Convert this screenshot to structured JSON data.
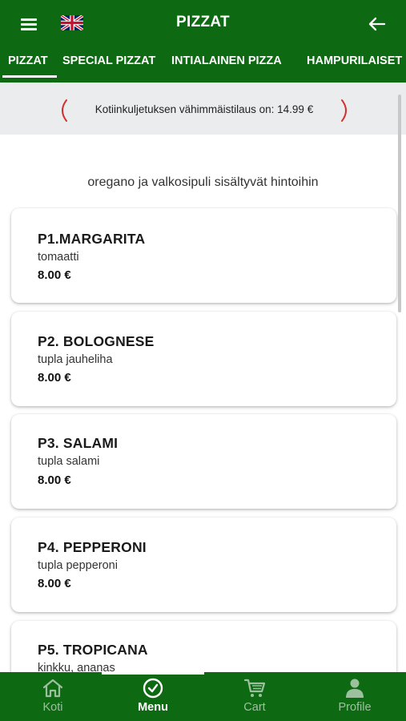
{
  "header": {
    "title": "PIZZAT",
    "language_icon": "uk-flag-icon",
    "menu_icon": "hamburger-menu-icon",
    "back_icon": "arrow-left-icon",
    "background_color": "#0d6a12"
  },
  "tabs": [
    {
      "label": "PIZZAT",
      "active": true
    },
    {
      "label": "SPECIAL PIZZAT",
      "active": false
    },
    {
      "label": "INTIALAINEN PIZZA",
      "active": false
    },
    {
      "label": "HAMPURILAISET",
      "active": false
    }
  ],
  "notice": {
    "text": "Kotiinkuljetuksen vähimmäistilaus on: 14.99 €",
    "accent_color": "#d32f2f"
  },
  "info_text": "oregano ja valkosipuli sisältyvät hintoihin",
  "menu_items": [
    {
      "name": "P1.MARGARITA",
      "description": "tomaatti",
      "price": "8.00 €"
    },
    {
      "name": "P2. BOLOGNESE",
      "description": "tupla jauheliha",
      "price": "8.00 €"
    },
    {
      "name": "P3. SALAMI",
      "description": "tupla salami",
      "price": "8.00 €"
    },
    {
      "name": "P4. PEPPERONI",
      "description": "tupla pepperoni",
      "price": "8.00 €"
    },
    {
      "name": "P5. TROPICANA",
      "description": "kinkku, ananas",
      "price": ""
    }
  ],
  "bottom_nav": [
    {
      "label": "Koti",
      "icon": "home-icon",
      "active": false
    },
    {
      "label": "Menu",
      "icon": "check-circle-icon",
      "active": true
    },
    {
      "label": "Cart",
      "icon": "cart-icon",
      "active": false
    },
    {
      "label": "Profile",
      "icon": "person-icon",
      "active": false
    }
  ],
  "colors": {
    "active_nav": "#ffffff",
    "inactive_nav": "#9dc09f"
  }
}
